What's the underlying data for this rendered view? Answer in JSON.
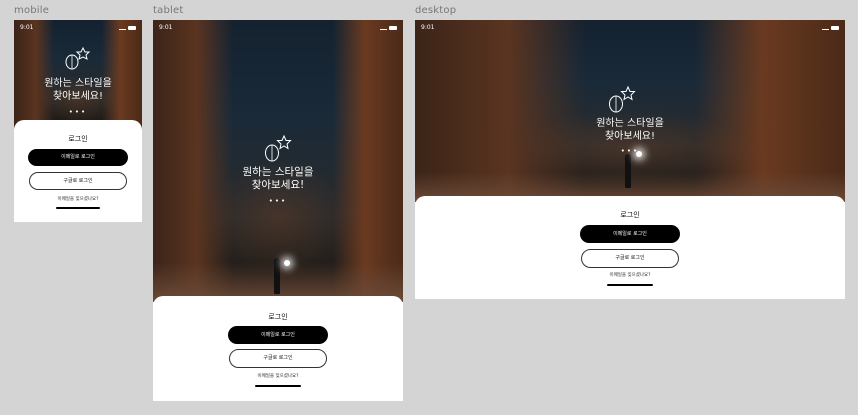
{
  "frames": {
    "mobile": "mobile",
    "tablet": "tablet",
    "desktop": "desktop"
  },
  "status": {
    "time": "9:01"
  },
  "hero": {
    "headline_line1": "원하는 스타일을",
    "headline_line2": "찾아보세요!",
    "dots": "•••"
  },
  "login": {
    "title": "로그인",
    "email_button": "이메일로 로그인",
    "google_button": "구글로 로그인",
    "forgot_link": "이메일을 잊으셨나요?"
  },
  "colors": {
    "background": "#d4d4d4",
    "primary_button": "#000000",
    "sheet": "#ffffff"
  },
  "icons": [
    "leaf-icon",
    "star-icon",
    "signal-icon",
    "wifi-icon",
    "battery-icon"
  ]
}
